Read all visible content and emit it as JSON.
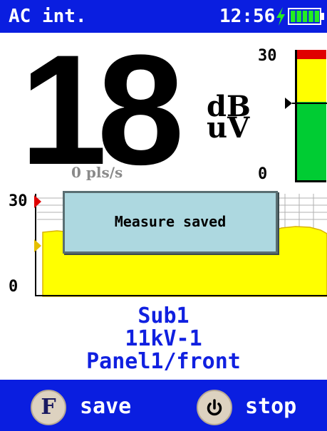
{
  "status_bar": {
    "mode": "AC int.",
    "time": "12:56",
    "charging_icon": "bolt-icon",
    "battery_icon": "battery-icon",
    "battery_level": 1.0,
    "background": "#0a1ee0"
  },
  "measurement": {
    "value": "18",
    "unit_line1": "dB",
    "unit_line2": "uV",
    "pulse_rate": "0 pls/s"
  },
  "level_bar": {
    "max_label": "30",
    "min_label": "0",
    "range": [
      0,
      30
    ],
    "current_level": 18,
    "marker_level": 18,
    "peak_color": "#e00000",
    "fill_color": "#00cc33",
    "background_color": "#ffff00"
  },
  "history_chart": {
    "max_label": "30",
    "min_label": "0",
    "range": [
      0,
      30
    ],
    "marker_level": 17,
    "fill_color": "#ffff00"
  },
  "toast": {
    "message": "Measure saved"
  },
  "location": {
    "line1": "Sub1",
    "line2": "11kV-1",
    "line3": "Panel1/front",
    "color": "#1020e0"
  },
  "softkeys": {
    "left_key_glyph": "F",
    "left_label": "save",
    "right_key_icon": "power-icon",
    "right_label": "stop"
  }
}
